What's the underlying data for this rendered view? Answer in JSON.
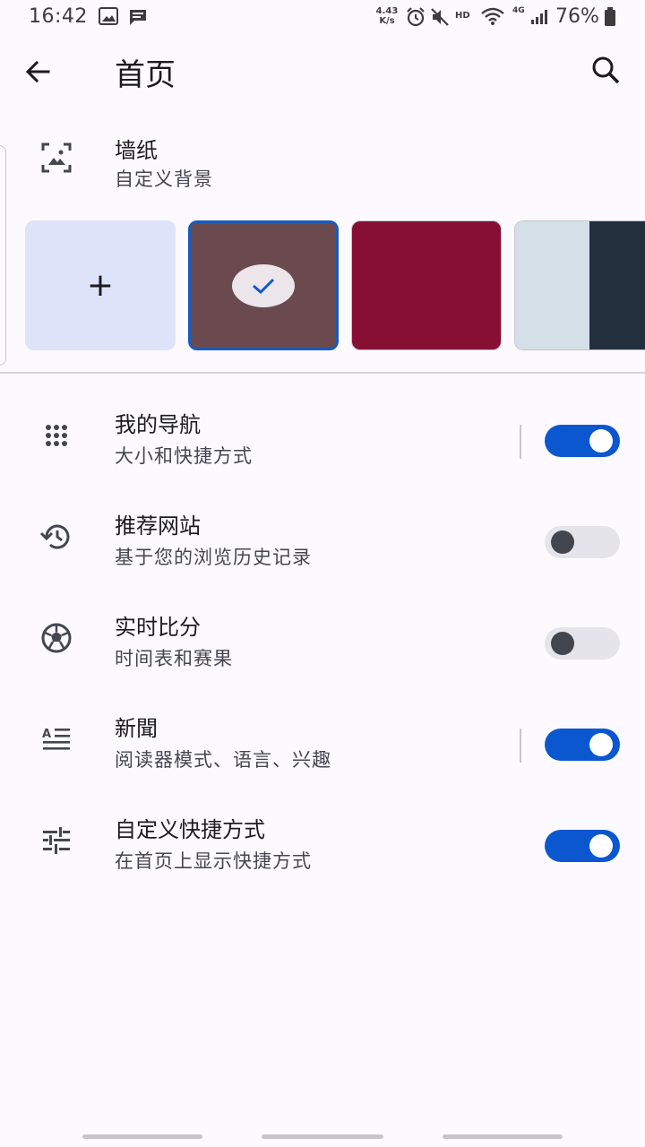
{
  "status_bar": {
    "time": "16:42",
    "net_speed_value": "4.43",
    "net_speed_unit": "K/s",
    "hd": "HD",
    "signal_type": "4G",
    "battery": "76%"
  },
  "header": {
    "title": "首页"
  },
  "wallpaper": {
    "title": "墙纸",
    "subtitle": "自定义背景",
    "add_label": "+",
    "colors": [
      "#dde3f8",
      "#6b4a4f",
      "#870f33",
      "#d5dfe8",
      "#22303d"
    ],
    "selected_index": 1
  },
  "settings": [
    {
      "title": "我的导航",
      "subtitle": "大小和快捷方式",
      "icon": "grid-dots-icon",
      "enabled": true
    },
    {
      "title": "推荐网站",
      "subtitle": "基于您的浏览历史记录",
      "icon": "history-icon",
      "enabled": false
    },
    {
      "title": "实时比分",
      "subtitle": "时间表和赛果",
      "icon": "soccer-ball-icon",
      "enabled": false
    },
    {
      "title": "新聞",
      "subtitle": "阅读器模式、语言、兴趣",
      "icon": "article-icon",
      "enabled": true
    },
    {
      "title": "自定义快捷方式",
      "subtitle": "在首页上显示快捷方式",
      "icon": "tune-icon",
      "enabled": true
    }
  ],
  "accent_color": "#0b57d0"
}
